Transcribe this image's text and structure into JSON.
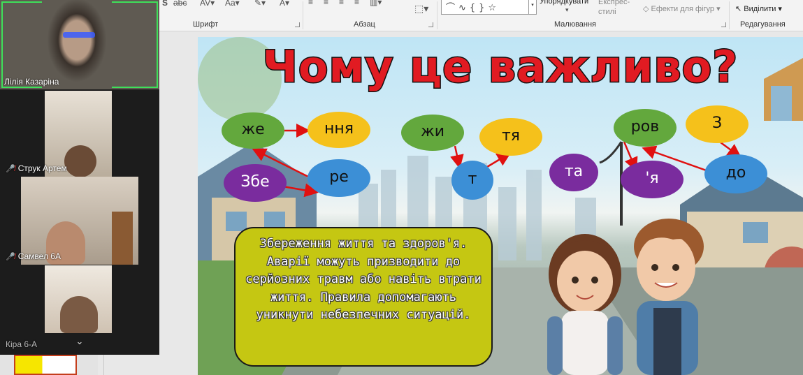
{
  "ribbon": {
    "groups": {
      "font": "Шрифт",
      "paragraph": "Абзац",
      "drawing": "Малювання",
      "editing": "Редагування"
    },
    "arrange_label": "Упорядкувати",
    "quick_styles_label": "Експрес-стилі",
    "shape_effects_label": "Ефекти для фігур",
    "select_label": "Виділити"
  },
  "participants": [
    {
      "name": "Лілія Казаріна",
      "muted": false,
      "active_speaker": true
    },
    {
      "name": "Струк Артем",
      "muted": true
    },
    {
      "name": "Самвел 6А",
      "muted": true
    },
    {
      "name": "Кіра 6-А",
      "muted": false
    }
  ],
  "slide": {
    "title": "Чому це важливо?",
    "syllables": {
      "zhe": "же",
      "nnia": "ння",
      "zbe": "Збе",
      "re": "ре",
      "zhy": "жи",
      "t": "т",
      "tia": "тя",
      "ta": "та",
      "rov": "ров",
      "z": "З",
      "ya": "'я",
      "do": "до"
    },
    "info_text": "Збереження життя та здоров'я. Аварії можуть призводити до серйозних травм або навіть втрати життя. Правила допомагають уникнути небезпечних ситуацій.",
    "colors": {
      "green": "#63a83d",
      "yellow": "#f5c11b",
      "purple": "#7a2c9e",
      "blue": "#3c8fd6",
      "title_red": "#e11b22",
      "box_yellow": "#c5c712"
    }
  }
}
